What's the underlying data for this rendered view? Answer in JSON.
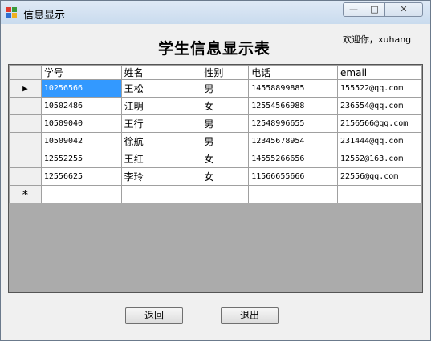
{
  "window": {
    "title": "信息显示",
    "minimize_glyph": "—",
    "maximize_glyph": "□",
    "close_glyph": "✕"
  },
  "header": {
    "heading": "学生信息显示表",
    "welcome": "欢迎你，xuhang"
  },
  "grid": {
    "columns": [
      "学号",
      "姓名",
      "性别",
      "电话",
      "email"
    ],
    "current_row_marker": "▶",
    "new_row_marker": "*",
    "rows": [
      [
        "10256566",
        "王松",
        "男",
        "14558899885",
        "155522@qq.com"
      ],
      [
        "10502486",
        "江明",
        "女",
        "12554566988",
        "236554@qq.com"
      ],
      [
        "10509040",
        "王行",
        "男",
        "12548996655",
        "2156566@qq.com"
      ],
      [
        "10509042",
        "徐航",
        "男",
        "12345678954",
        "231444@qq.com"
      ],
      [
        "12552255",
        "王红",
        "女",
        "14555266656",
        "12552@163.com"
      ],
      [
        "12556625",
        "李玲",
        "女",
        "11566655666",
        "22556@qq.com"
      ]
    ]
  },
  "buttons": {
    "back": "返回",
    "exit": "退出"
  },
  "colors": {
    "selection": "#3399ff",
    "grid_background": "#ababab"
  }
}
